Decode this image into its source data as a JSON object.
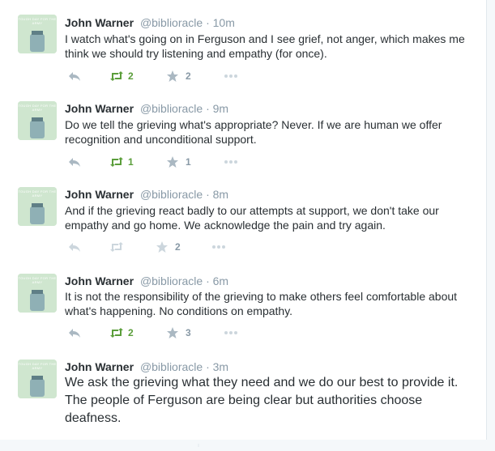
{
  "author": {
    "name": "John Warner",
    "handle": "@biblioracle",
    "separator": "·"
  },
  "avatar_text": "TOUGH DAY FOR THE ARMY",
  "colors": {
    "retweet_active": "#5b9e3b",
    "muted": "#8899a6",
    "border": "#e1e8ed"
  },
  "icons": {
    "reply": "reply-icon",
    "retweet": "retweet-icon",
    "favorite": "star-icon",
    "more": "more-icon"
  },
  "tweets": [
    {
      "time": "10m",
      "text": "I watch what's going on in Ferguson and I see grief, not anger, which makes me think we should try listening and empathy (for once).",
      "retweets": "2",
      "favorites": "2"
    },
    {
      "time": "9m",
      "text": "Do we tell the grieving what's appropriate? Never. If we are human we offer recognition and unconditional support.",
      "retweets": "1",
      "favorites": "1"
    },
    {
      "time": "8m",
      "text": "And if the grieving react badly to our attempts at support, we don't take our empathy and go home. We acknowledge the pain and try again.",
      "retweets": "",
      "favorites": "2"
    },
    {
      "time": "6m",
      "text": "It is not the responsibility of the grieving to make others feel comfortable about what's happening. No conditions on empathy.",
      "retweets": "2",
      "favorites": "3"
    },
    {
      "time": "3m",
      "text": "We ask the grieving what they need and we do our best to provide it. The people of Ferguson are being clear but authorities choose deafness.",
      "retweets": "",
      "favorites": ""
    }
  ]
}
